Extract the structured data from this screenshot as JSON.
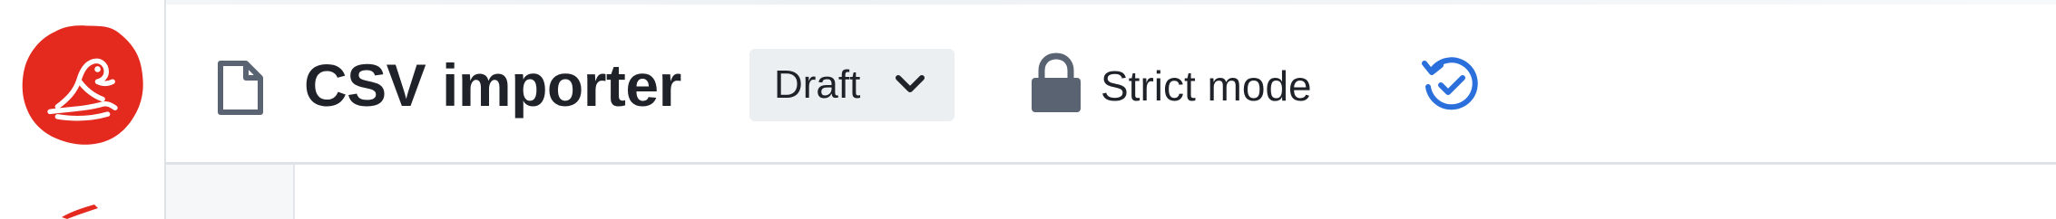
{
  "header": {
    "title": "CSV importer",
    "doc_icon": "document-icon",
    "status": {
      "label": "Draft",
      "icon": "chevron-down-icon"
    },
    "mode": {
      "icon": "lock-icon",
      "label": "Strict mode"
    },
    "sync_icon": "sync-check-icon"
  },
  "logo": {
    "icon": "seal-logo-icon",
    "color": "#e4291f"
  },
  "colors": {
    "accent_blue": "#2a6fdb",
    "text": "#1f2329",
    "icon_gray": "#5a6372",
    "border": "#dfe3e8",
    "dropdown_bg": "#eceff2"
  }
}
